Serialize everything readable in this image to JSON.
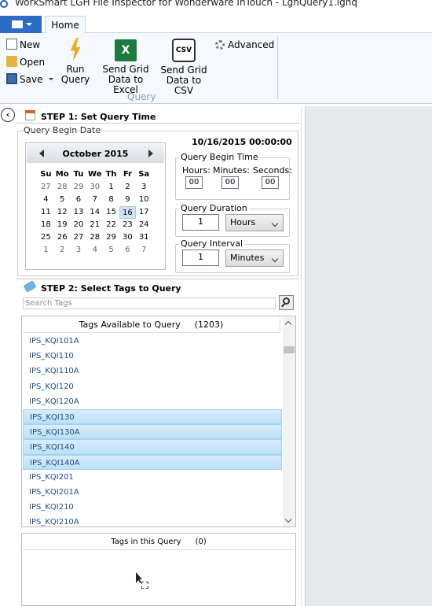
{
  "window": {
    "title": "WorkSmart LGH File Inspector for Wonderware InTouch - LghQuery1.lghq"
  },
  "ribbon": {
    "tabs": [
      {
        "label": "Home"
      }
    ],
    "small_buttons": {
      "new": "New",
      "open": "Open",
      "save": "Save"
    },
    "run_query": {
      "line1": "Run",
      "line2": "Query"
    },
    "send_excel": {
      "line1": "Send Grid",
      "line2": "Data to Excel",
      "icon_text": "X"
    },
    "send_csv": {
      "line1": "Send Grid",
      "line2": "Data to CSV",
      "icon_text": "CSV"
    },
    "advanced": "Advanced",
    "group_label": "Query"
  },
  "step1": {
    "title": "STEP 1: Set Query Time",
    "query_begin_date_label": "Query Begin Date",
    "calendar": {
      "month": "October 2015",
      "weekdays": [
        "Su",
        "Mo",
        "Tu",
        "We",
        "Th",
        "Fr",
        "Sa"
      ],
      "weeks": [
        [
          {
            "d": "27",
            "o": true
          },
          {
            "d": "28",
            "o": true
          },
          {
            "d": "29",
            "o": true
          },
          {
            "d": "30",
            "o": true
          },
          {
            "d": "1"
          },
          {
            "d": "2"
          },
          {
            "d": "3"
          }
        ],
        [
          {
            "d": "4"
          },
          {
            "d": "5"
          },
          {
            "d": "6"
          },
          {
            "d": "7"
          },
          {
            "d": "8"
          },
          {
            "d": "9"
          },
          {
            "d": "10"
          }
        ],
        [
          {
            "d": "11"
          },
          {
            "d": "12"
          },
          {
            "d": "13"
          },
          {
            "d": "14"
          },
          {
            "d": "15"
          },
          {
            "d": "16",
            "t": true
          },
          {
            "d": "17"
          }
        ],
        [
          {
            "d": "18"
          },
          {
            "d": "19"
          },
          {
            "d": "20"
          },
          {
            "d": "21"
          },
          {
            "d": "22"
          },
          {
            "d": "23"
          },
          {
            "d": "24"
          }
        ],
        [
          {
            "d": "25"
          },
          {
            "d": "26"
          },
          {
            "d": "27"
          },
          {
            "d": "28"
          },
          {
            "d": "29"
          },
          {
            "d": "30"
          },
          {
            "d": "31"
          }
        ],
        [
          {
            "d": "1",
            "o": true
          },
          {
            "d": "2",
            "o": true
          },
          {
            "d": "3",
            "o": true
          },
          {
            "d": "4",
            "o": true
          },
          {
            "d": "5",
            "o": true
          },
          {
            "d": "6",
            "o": true
          },
          {
            "d": "7",
            "o": true
          }
        ]
      ]
    },
    "selected_datetime": "10/16/2015 00:00:00",
    "begin_time": {
      "legend": "Query Begin Time",
      "hours_label": "Hours:",
      "minutes_label": "Minutes:",
      "seconds_label": "Seconds:",
      "hours": "00",
      "minutes": "00",
      "seconds": "00"
    },
    "duration": {
      "legend": "Query Duration",
      "value": "1",
      "unit": "Hours"
    },
    "interval": {
      "legend": "Query Interval",
      "value": "1",
      "unit": "Minutes"
    }
  },
  "step2": {
    "title": "STEP 2: Select Tags to Query",
    "search_placeholder": "Search Tags",
    "available": {
      "header": "Tags Available to Query",
      "count": "(1203)",
      "tags": [
        {
          "name": "IPS_KQI101A",
          "selected": false
        },
        {
          "name": "IPS_KQI110",
          "selected": false
        },
        {
          "name": "IPS_KQI110A",
          "selected": false
        },
        {
          "name": "IPS_KQI120",
          "selected": false
        },
        {
          "name": "IPS_KQI120A",
          "selected": false
        },
        {
          "name": "IPS_KQI130",
          "selected": true
        },
        {
          "name": "IPS_KQI130A",
          "selected": true
        },
        {
          "name": "IPS_KQI140",
          "selected": true
        },
        {
          "name": "IPS_KQI140A",
          "selected": true
        },
        {
          "name": "IPS_KQI201",
          "selected": false
        },
        {
          "name": "IPS_KQI201A",
          "selected": false
        },
        {
          "name": "IPS_KQI210",
          "selected": false
        },
        {
          "name": "IPS_KQI210A",
          "selected": false
        }
      ]
    },
    "in_query": {
      "header": "Tags in this Query",
      "count": "(0)"
    }
  },
  "colors": {
    "accent": "#2b6cc4",
    "selection": "#bde0f6",
    "link": "#1f4e8c"
  }
}
